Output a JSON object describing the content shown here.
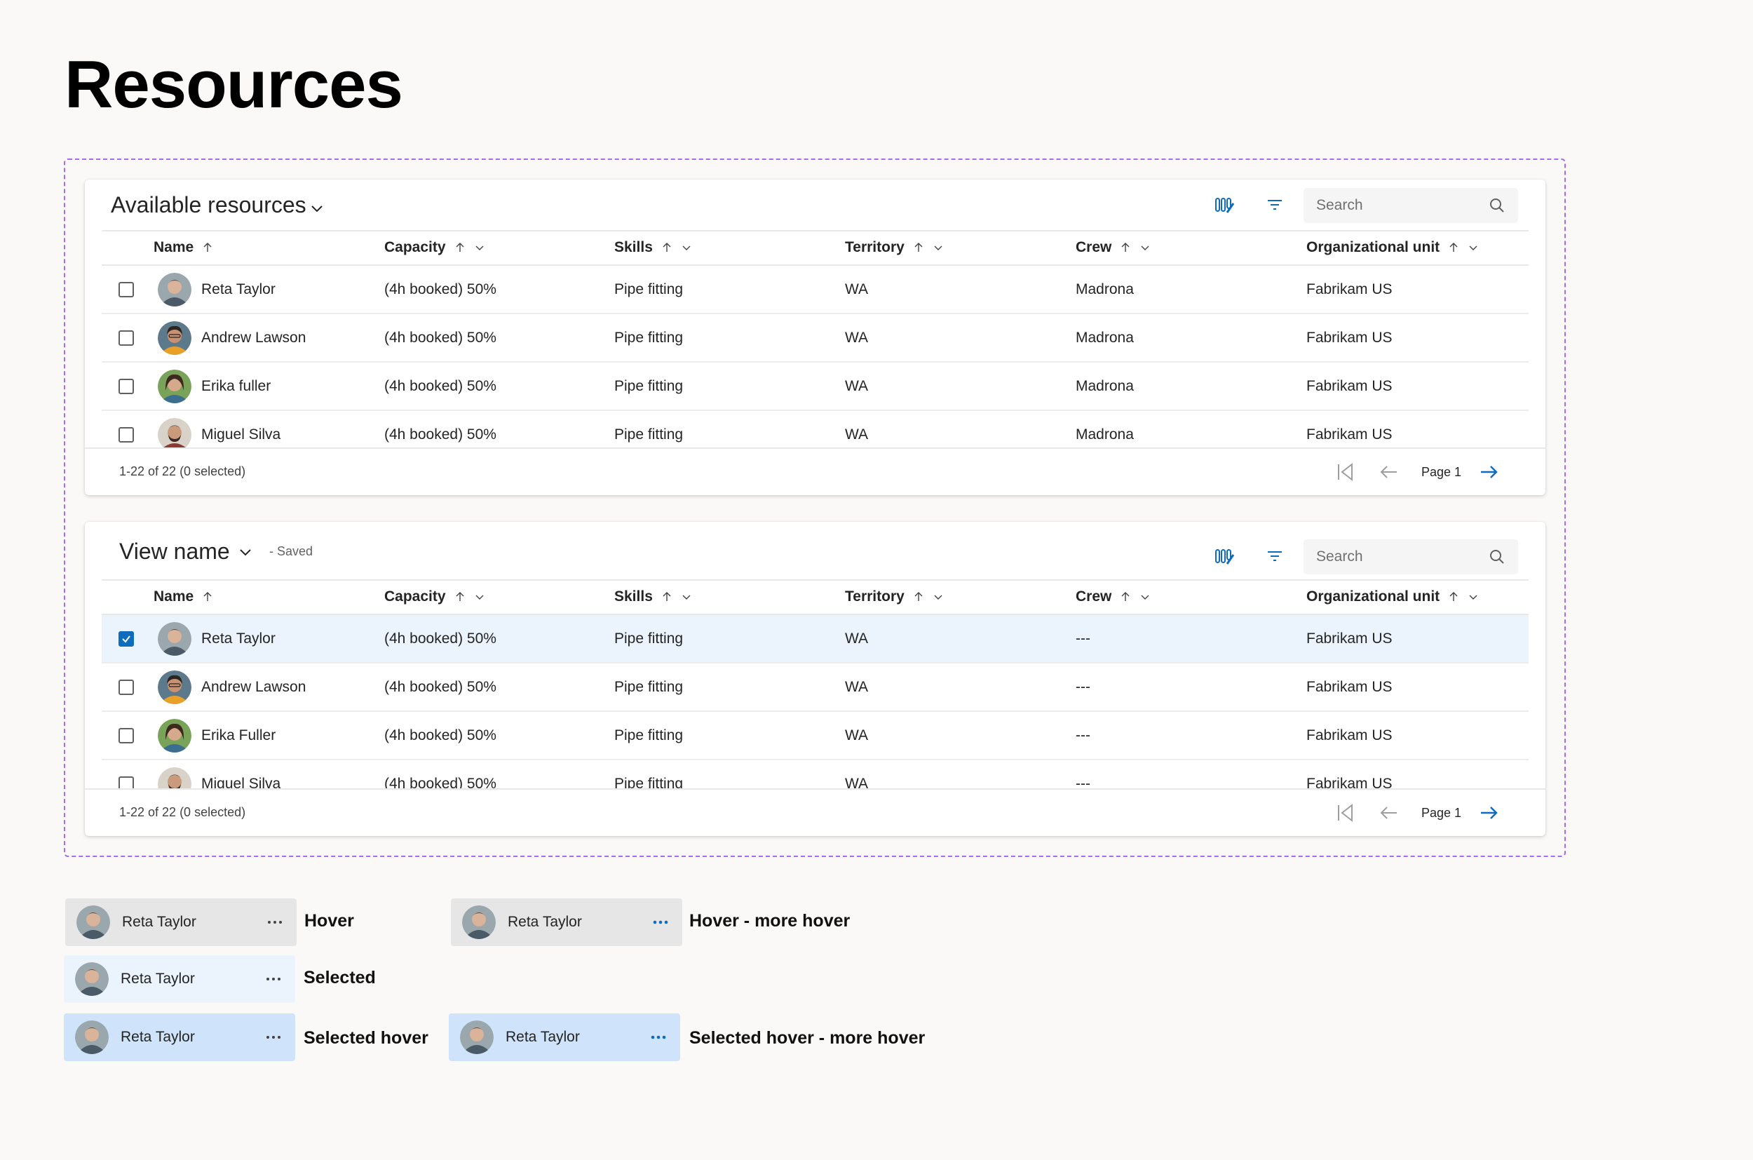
{
  "page": {
    "title": "Resources"
  },
  "colors": {
    "accent": "#0f6cbd",
    "selected_bg": "#ebf3fc",
    "hover_bg": "#e6e6e6",
    "selected_hover_bg": "#cfe4fa",
    "frame_border": "#a66bf0"
  },
  "card1": {
    "title": "Available resources",
    "search_placeholder": "Search",
    "columns": [
      "Name",
      "Capacity",
      "Skills",
      "Territory",
      "Crew",
      "Organizational unit"
    ],
    "rows": [
      {
        "name": "Reta Taylor",
        "capacity": "(4h booked) 50%",
        "skills": "Pipe fitting",
        "territory": "WA",
        "crew": "Madrona",
        "org": "Fabrikam US"
      },
      {
        "name": "Andrew Lawson",
        "capacity": "(4h booked) 50%",
        "skills": "Pipe fitting",
        "territory": "WA",
        "crew": "Madrona",
        "org": "Fabrikam US"
      },
      {
        "name": "Erika fuller",
        "capacity": "(4h booked) 50%",
        "skills": "Pipe fitting",
        "territory": "WA",
        "crew": "Madrona",
        "org": "Fabrikam US"
      },
      {
        "name": "Miguel Silva",
        "capacity": "(4h booked) 50%",
        "skills": "Pipe fitting",
        "territory": "WA",
        "crew": "Madrona",
        "org": "Fabrikam US"
      }
    ],
    "footer": {
      "count": "1-22 of 22 (0 selected)",
      "page": "Page 1"
    }
  },
  "card2": {
    "title": "View name",
    "saved": "- Saved",
    "search_placeholder": "Search",
    "columns": [
      "Name",
      "Capacity",
      "Skills",
      "Territory",
      "Crew",
      "Organizational unit"
    ],
    "rows": [
      {
        "name": "Reta Taylor",
        "capacity": "(4h booked) 50%",
        "skills": "Pipe fitting",
        "territory": "WA",
        "crew": "---",
        "org": "Fabrikam US"
      },
      {
        "name": "Andrew Lawson",
        "capacity": "(4h booked) 50%",
        "skills": "Pipe fitting",
        "territory": "WA",
        "crew": "---",
        "org": "Fabrikam US"
      },
      {
        "name": "Erika Fuller",
        "capacity": "(4h booked) 50%",
        "skills": "Pipe fitting",
        "territory": "WA",
        "crew": "---",
        "org": "Fabrikam US"
      },
      {
        "name": "Miguel Silva",
        "capacity": "(4h booked) 50%",
        "skills": "Pipe fitting",
        "territory": "WA",
        "crew": "---",
        "org": "Fabrikam US"
      }
    ],
    "footer": {
      "count": "1-22 of 22 (0 selected)",
      "page": "Page 1"
    }
  },
  "states": [
    {
      "name": "Reta Taylor",
      "label": "Hover"
    },
    {
      "name": "Reta Taylor",
      "label": "Hover - more hover"
    },
    {
      "name": "Reta Taylor",
      "label": "Selected"
    },
    {
      "name": "Reta Taylor",
      "label": "Selected hover"
    },
    {
      "name": "Reta Taylor",
      "label": "Selected hover - more hover"
    }
  ]
}
